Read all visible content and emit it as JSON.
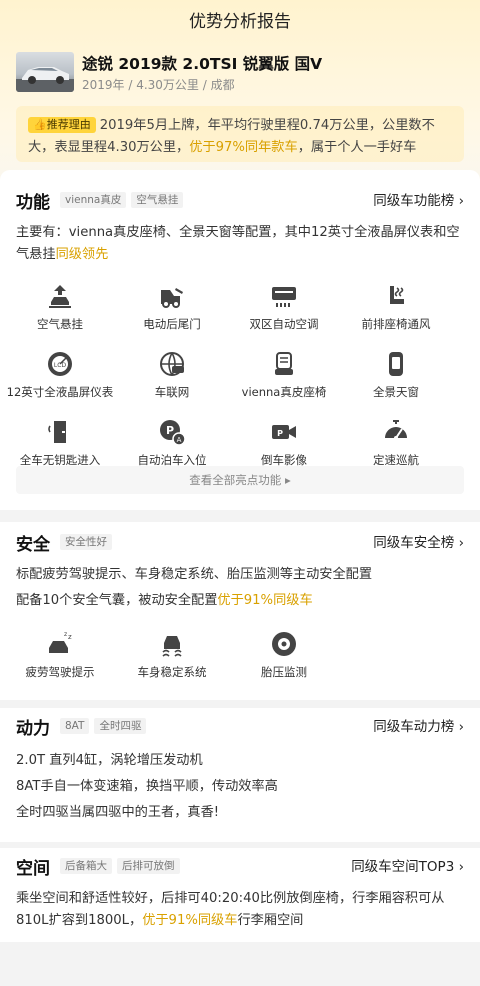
{
  "header": {
    "title": "优势分析报告"
  },
  "car": {
    "name": "途锐 2019款 2.0TSI 锐翼版 国V",
    "meta": "2019年 / 4.30万公里 / 成都"
  },
  "reason": {
    "tag": "推荐理由",
    "text_1": "2019年5月上牌，年平均行驶里程0.74万公里，公里数不大，表显里程4.30万公里，",
    "highlight": "优于97%同年款车",
    "text_2": "，属于个人一手好车"
  },
  "features": {
    "title": "功能",
    "tags": [
      "vienna真皮",
      "空气悬挂"
    ],
    "rank": "同级车功能榜",
    "desc": "主要有：vienna真皮座椅、全景天窗等配置，其中12英寸全液晶屏仪表和空气悬挂",
    "desc_hl": "同级领先",
    "items": [
      {
        "label": "空气悬挂",
        "icon": "air-suspension-icon"
      },
      {
        "label": "电动后尾门",
        "icon": "power-tailgate-icon"
      },
      {
        "label": "双区自动空调",
        "icon": "dual-zone-ac-icon"
      },
      {
        "label": "前排座椅通风",
        "icon": "seat-ventilation-icon"
      },
      {
        "label": "12英寸全液晶屏仪表",
        "icon": "lcd-gauge-icon"
      },
      {
        "label": "车联网",
        "icon": "connected-car-icon"
      },
      {
        "label": "vienna真皮座椅",
        "icon": "leather-seat-icon"
      },
      {
        "label": "全景天窗",
        "icon": "panoramic-roof-icon"
      },
      {
        "label": "全车无钥匙进入",
        "icon": "keyless-entry-icon"
      },
      {
        "label": "自动泊车入位",
        "icon": "auto-parking-icon"
      },
      {
        "label": "倒车影像",
        "icon": "reverse-camera-icon"
      },
      {
        "label": "定速巡航",
        "icon": "cruise-control-icon"
      }
    ],
    "view_all": "查看全部亮点功能"
  },
  "safety": {
    "title": "安全",
    "tags": [
      "安全性好"
    ],
    "rank": "同级车安全榜",
    "line1": "标配疲劳驾驶提示、车身稳定系统、胎压监测等主动安全配置",
    "line2": "配备10个安全气囊，被动安全配置",
    "line2_hl": "优于91%同级车",
    "items": [
      {
        "label": "疲劳驾驶提示",
        "icon": "fatigue-warning-icon"
      },
      {
        "label": "车身稳定系统",
        "icon": "stability-control-icon"
      },
      {
        "label": "胎压监测",
        "icon": "tire-pressure-icon"
      }
    ]
  },
  "power": {
    "title": "动力",
    "tags": [
      "8AT",
      "全时四驱"
    ],
    "rank": "同级车动力榜",
    "lines": [
      "2.0T 直列4缸，涡轮增压发动机",
      "8AT手自一体变速箱，换挡平顺，传动效率高",
      "全时四驱当属四驱中的王者，真香!"
    ]
  },
  "space": {
    "title": "空间",
    "tags": [
      "后备箱大",
      "后排可放倒"
    ],
    "rank": "同级车空间TOP3",
    "text": "乘坐空间和舒适性较好，后排可40:20:40比例放倒座椅，行李厢容积可从810L扩容到1800L，",
    "hl": "优于91%同级车",
    "text_2": "行李厢空间"
  },
  "colors": {
    "accent": "#d9a100",
    "tag_yellow": "#ffd43b"
  }
}
